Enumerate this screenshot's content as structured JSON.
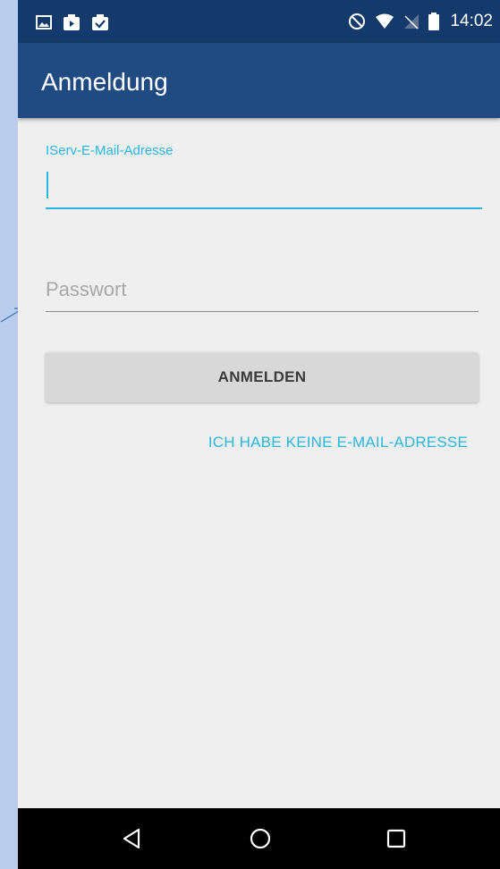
{
  "status_bar": {
    "time": "14:02",
    "left_icons": [
      "image-icon",
      "video-notification-icon",
      "check-notification-icon"
    ],
    "right_icons": [
      "do-not-disturb-icon",
      "wifi-icon",
      "no-signal-icon",
      "battery-icon"
    ]
  },
  "app_bar": {
    "title": "Anmeldung"
  },
  "form": {
    "email_label": "IServ-E-Mail-Adresse",
    "email_value": "",
    "password_placeholder": "Passwort",
    "password_value": "",
    "login_button": "ANMELDEN",
    "no_email_link": "ICH HABE KEINE E-MAIL-ADRESSE"
  },
  "nav_bar": {
    "buttons": [
      "back-icon",
      "home-icon",
      "recents-icon"
    ]
  },
  "colors": {
    "status_bar": "#133a6b",
    "app_bar": "#1f4a82",
    "accent": "#2bb6e0",
    "background": "#efefef",
    "button": "#d8d8d8"
  }
}
